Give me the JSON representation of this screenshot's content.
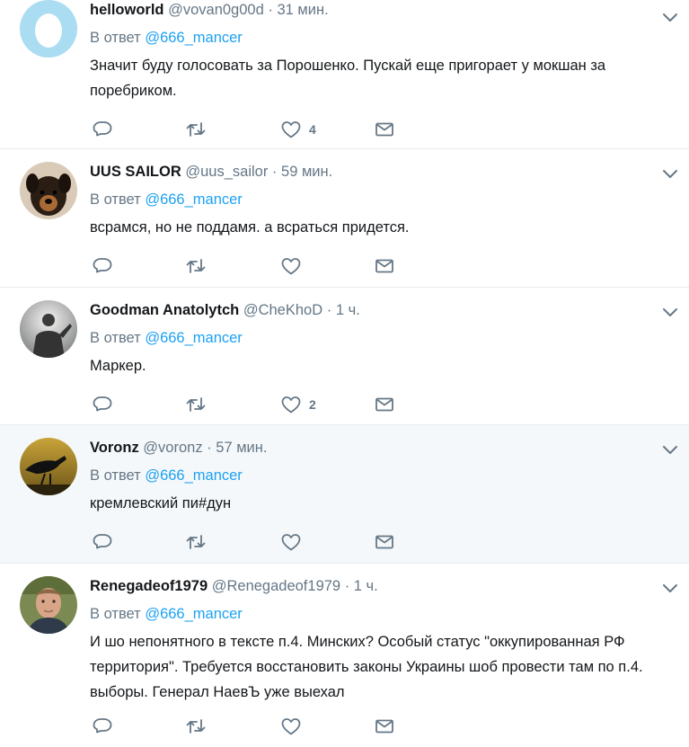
{
  "reply_prefix": "В ответ",
  "colors": {
    "link": "#1da1f2",
    "secondary": "#657786",
    "text": "#14171a",
    "border": "#e6ecf0",
    "highlight_bg": "#f5f8fa"
  },
  "icons": [
    "chevron-down-icon",
    "reply-icon",
    "retweet-icon",
    "heart-icon",
    "direct-message-icon"
  ],
  "tweets": [
    {
      "fullname": "helloworld",
      "username": "@vovan0g00d",
      "time": "31 мин.",
      "reply_to": "@666_mancer",
      "text": "Значит буду голосовать за Порошенко. Пускай еще пригорает у мокшан за поребриком.",
      "like_count": "4",
      "avatar": "egg-avatar"
    },
    {
      "fullname": "UUS SAILOR",
      "username": "@uus_sailor",
      "time": "59 мин.",
      "reply_to": "@666_mancer",
      "text": "всрамся, но не поддамя. а всраться придется.",
      "like_count": "",
      "avatar": "dog-avatar"
    },
    {
      "fullname": "Goodman Anatolytch",
      "username": "@CheKhoD",
      "time": "1 ч.",
      "reply_to": "@666_mancer",
      "text": "Маркер.",
      "like_count": "2",
      "avatar": "silhouette-avatar"
    },
    {
      "fullname": "Voronz",
      "username": "@voronz",
      "time": "57 мин.",
      "reply_to": "@666_mancer",
      "text": "кремлевский пи#дун",
      "like_count": "",
      "avatar": "crow-avatar"
    },
    {
      "fullname": "Renegadeof1979",
      "username": "@Renegadeof1979",
      "time": "1 ч.",
      "reply_to": "@666_mancer",
      "text": "И шо непонятного в тексте п.4. Минских? Особый статус \"оккупированная РФ территория\". Требуется восстановить законы Украины шоб провести там по п.4. выборы. Генерал НаевЪ уже выехал",
      "like_count": "",
      "avatar": "man-photo-avatar"
    }
  ]
}
